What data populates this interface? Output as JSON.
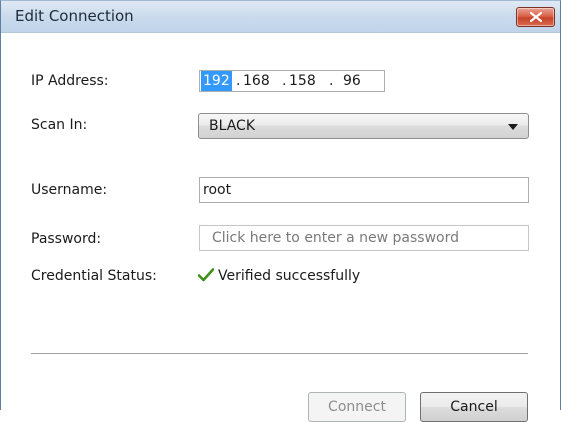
{
  "window": {
    "title": "Edit Connection"
  },
  "form": {
    "ip_label": "IP Address:",
    "ip": {
      "seg1": "192",
      "seg2": "168",
      "seg3": "158",
      "seg4": "96",
      "dot": "."
    },
    "scan_label": "Scan In:",
    "scan_value": "BLACK",
    "username_label": "Username:",
    "username_value": "root",
    "password_label": "Password:",
    "password_placeholder": "Click here to enter a new password",
    "status_label": "Credential Status:",
    "status_text": "Verified successfully"
  },
  "buttons": {
    "connect": "Connect",
    "cancel": "Cancel"
  },
  "icons": {
    "close": "close-icon",
    "check": "checkmark-icon",
    "dropdown": "chevron-down-icon"
  },
  "colors": {
    "selection": "#3399ff",
    "check": "#3f8f1a",
    "close": "#c7432a"
  }
}
